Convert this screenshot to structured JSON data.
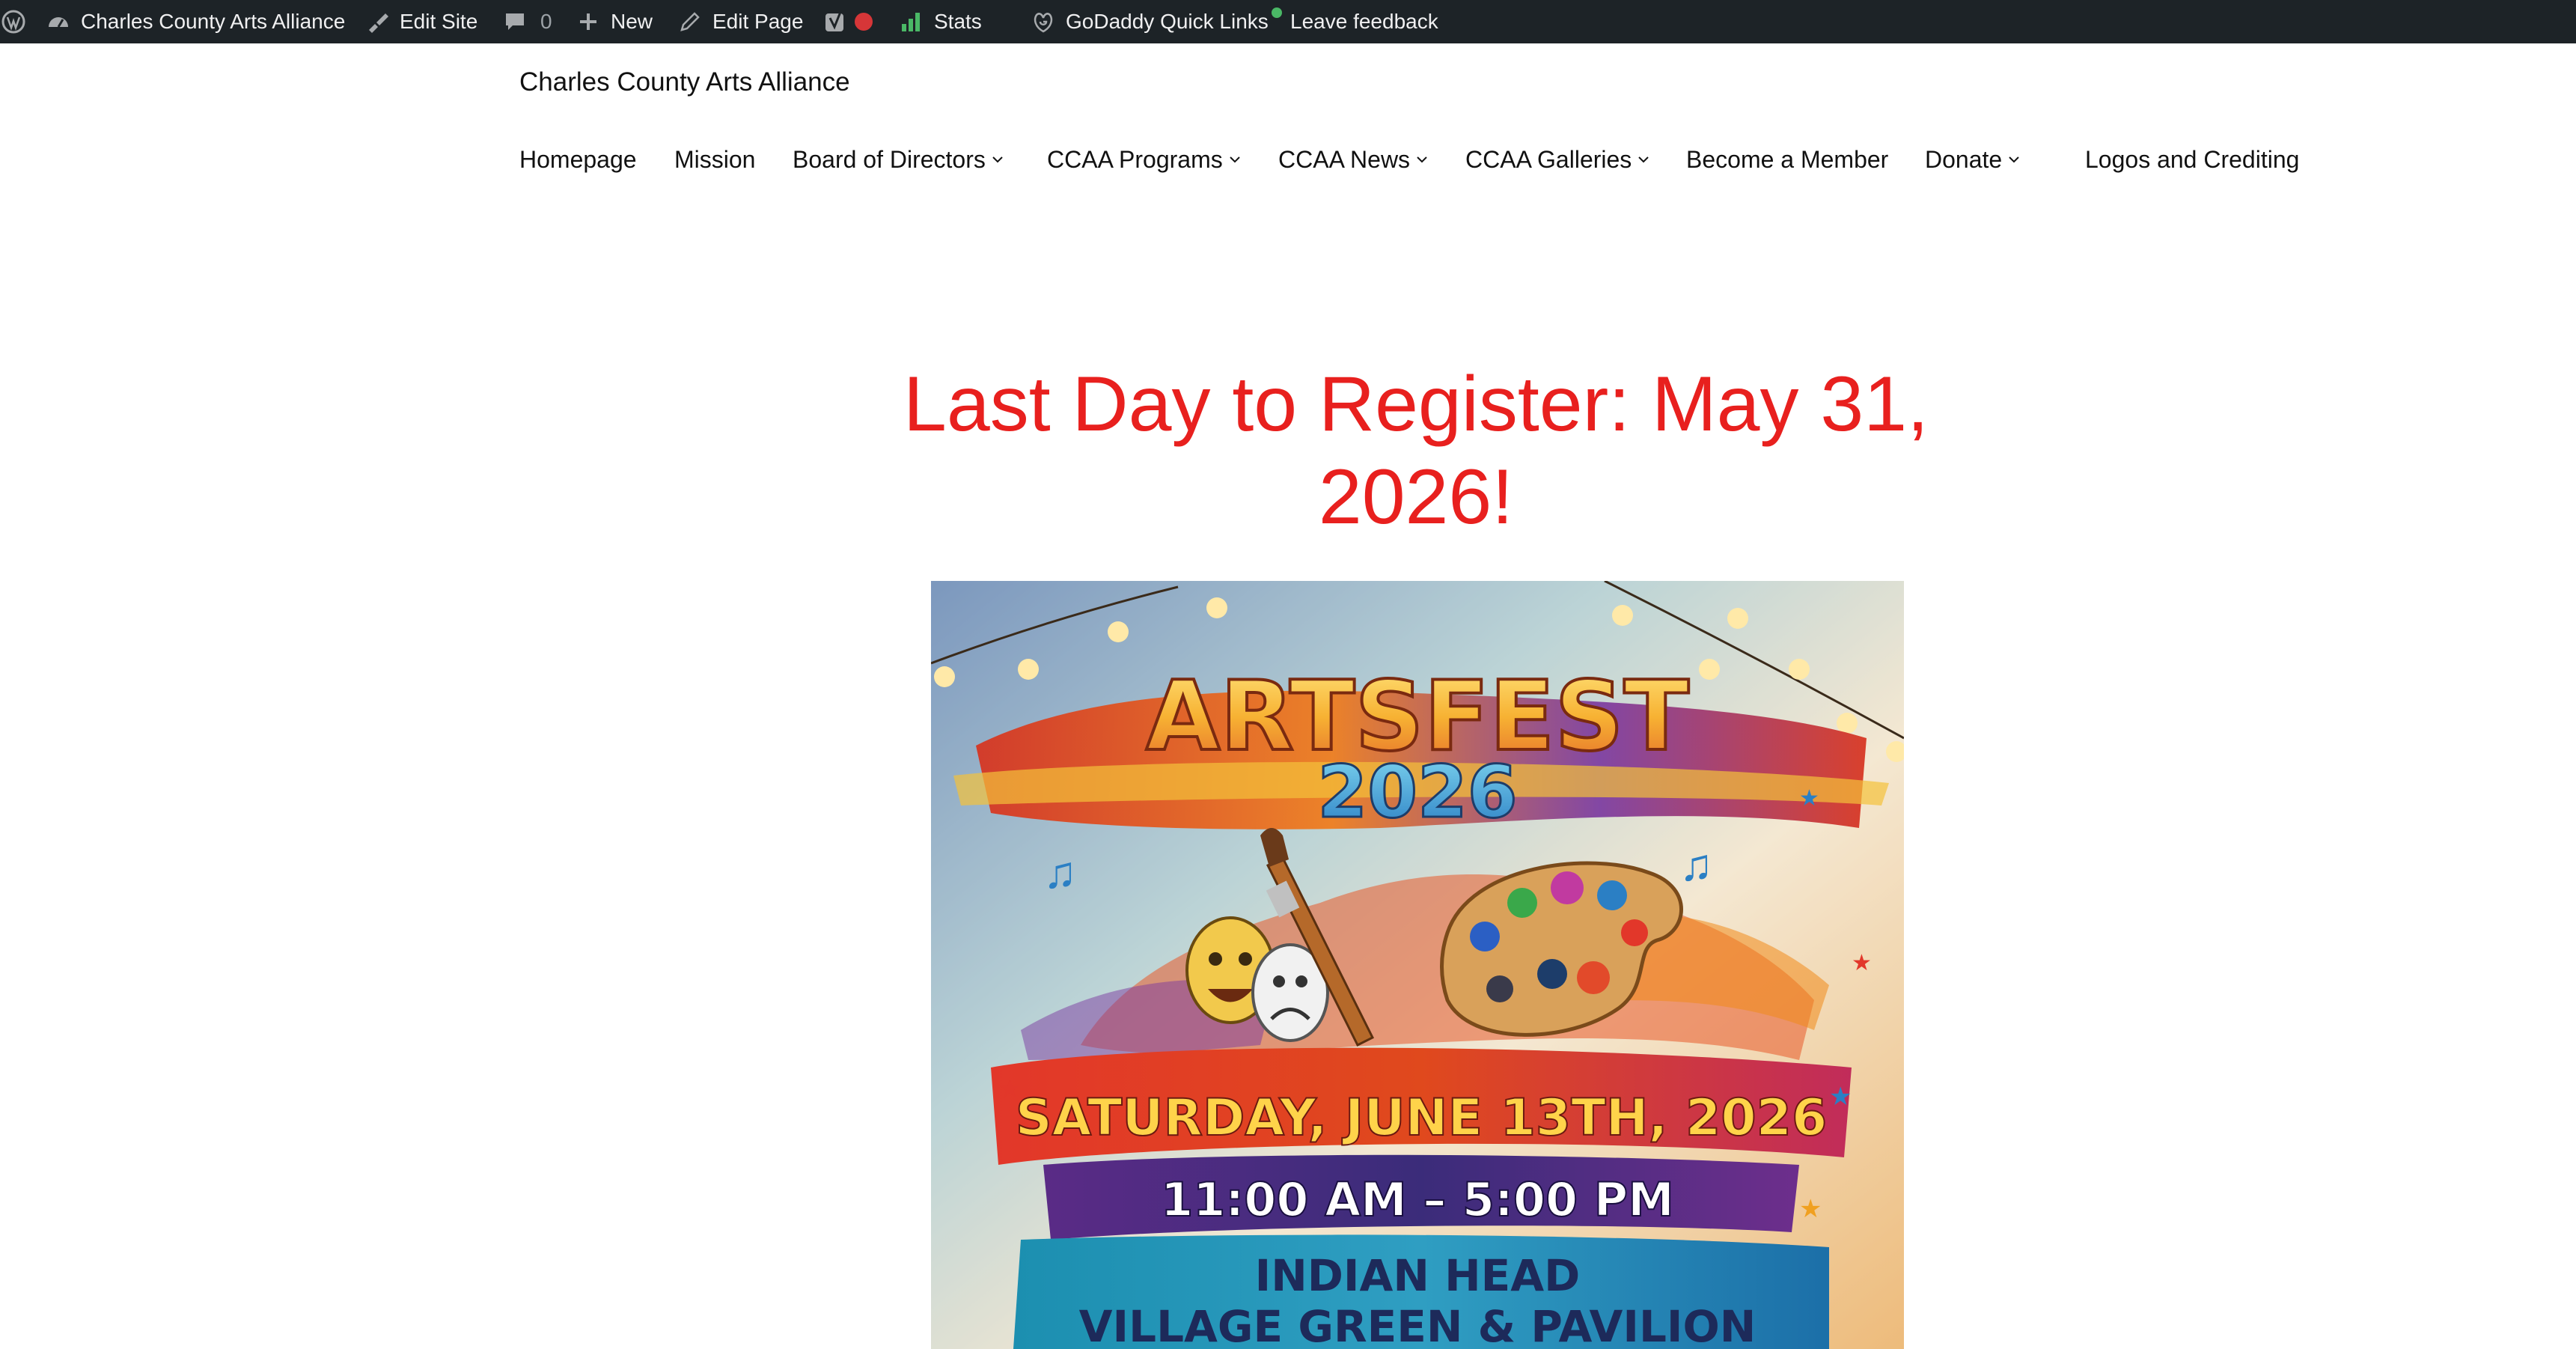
{
  "admin_bar": {
    "site_name": "Charles County Arts Alliance",
    "edit_site": "Edit Site",
    "comments_count": "0",
    "new": "New",
    "edit_page": "Edit Page",
    "stats": "Stats",
    "godaddy": "GoDaddy Quick Links",
    "feedback": "Leave feedback",
    "status_dot_color": "#d63638",
    "online_dot_color": "#4ab866",
    "stats_bar_color": "#4ab866"
  },
  "site": {
    "title": "Charles County Arts Alliance"
  },
  "nav": {
    "items": [
      {
        "label": "Homepage",
        "has_submenu": false
      },
      {
        "label": "Mission",
        "has_submenu": false
      },
      {
        "label": "Board of Directors",
        "has_submenu": true
      },
      {
        "label": "CCAA Programs",
        "has_submenu": true
      },
      {
        "label": "CCAA News",
        "has_submenu": true
      },
      {
        "label": "CCAA Galleries",
        "has_submenu": true
      },
      {
        "label": "Become a Member",
        "has_submenu": false
      },
      {
        "label": "Donate",
        "has_submenu": true
      },
      {
        "label": "Logos and Crediting",
        "has_submenu": false
      }
    ]
  },
  "main": {
    "headline_line1": "Last Day to Register: May 31,",
    "headline_line2": "2026!",
    "headline_color": "#e8201e"
  },
  "poster": {
    "title": "ARTSFEST",
    "year": "2026",
    "date": "SATURDAY, JUNE 13TH, 2026",
    "time": "11:00 AM – 5:00 PM",
    "venue_line1": "INDIAN HEAD",
    "venue_line2": "VILLAGE GREEN & PAVILION"
  }
}
